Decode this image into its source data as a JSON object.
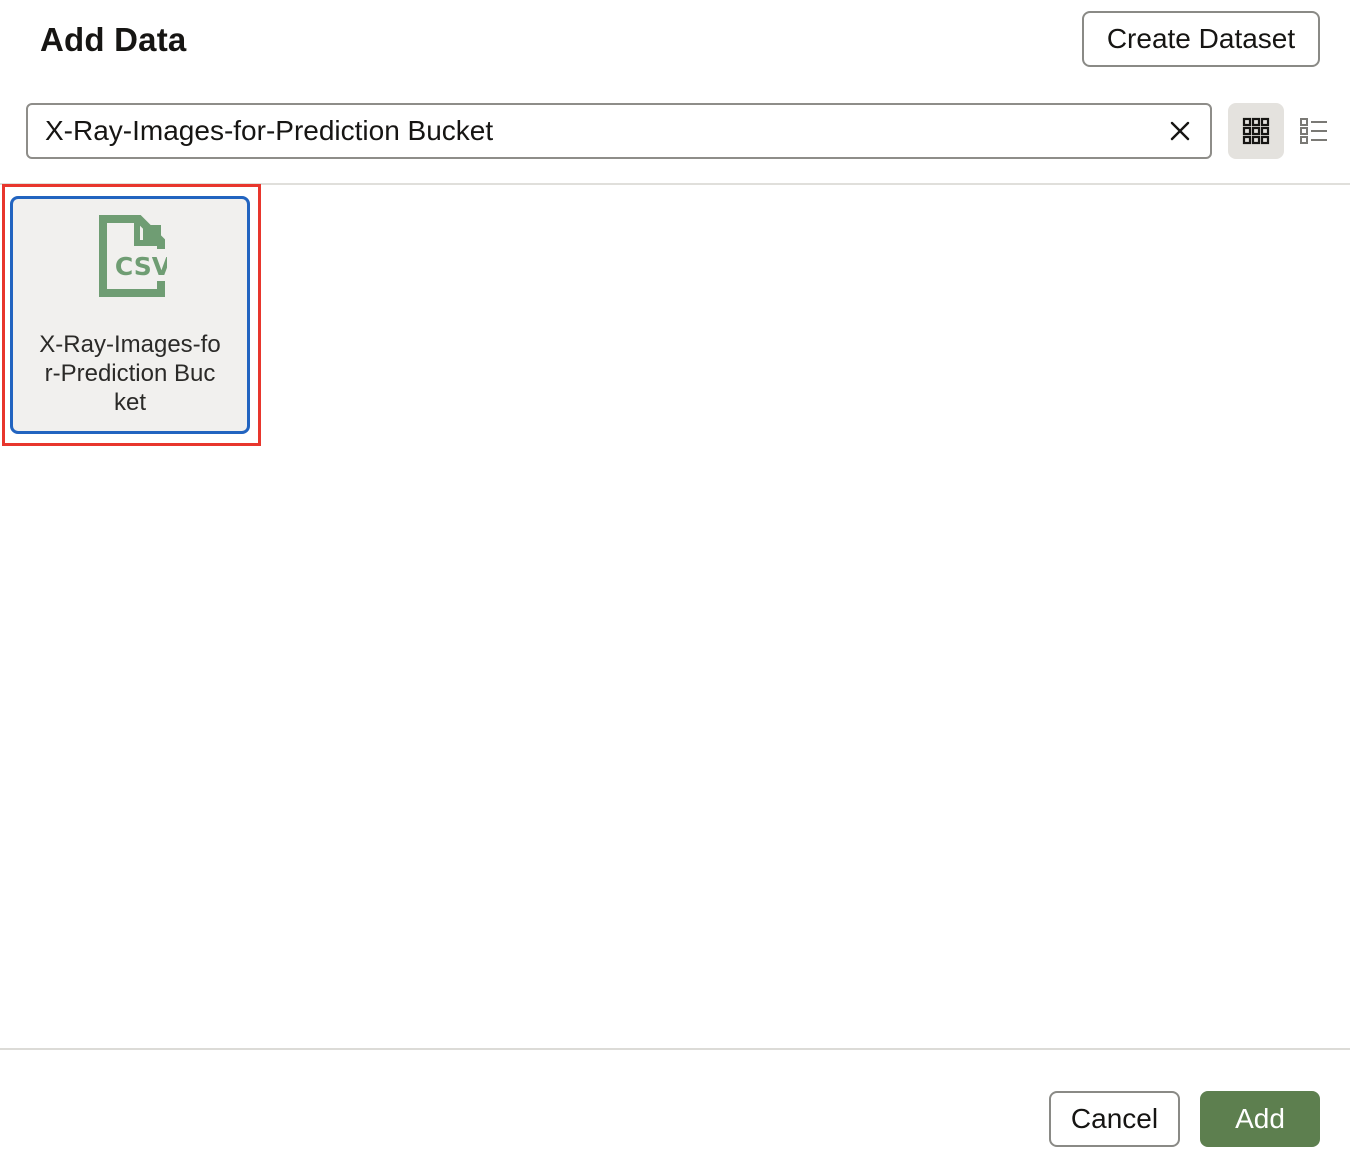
{
  "dialog": {
    "title": "Add Data",
    "create_button_label": "Create Dataset"
  },
  "search": {
    "value": "X-Ray-Images-for-Prediction Bucket"
  },
  "view_toggle": {
    "active": "grid",
    "grid_icon": "grid-icon",
    "list_icon": "list-icon"
  },
  "items": [
    {
      "icon": "csv-file-icon",
      "icon_text": "CSV",
      "label": "X-Ray-Images-for-Prediction Bucket",
      "selected": true
    }
  ],
  "footer": {
    "cancel_label": "Cancel",
    "add_label": "Add"
  },
  "colors": {
    "accent_green": "#5d7f4f",
    "csv_icon": "#6f9d73",
    "selection_blue": "#2264c0",
    "highlight_red": "#e8362d"
  }
}
